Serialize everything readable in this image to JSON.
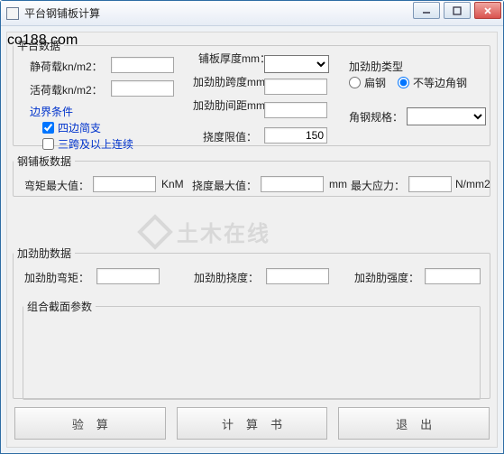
{
  "window": {
    "title": "平台钢铺板计算"
  },
  "platform": {
    "legend": "平台数据",
    "static_load_label": "静荷载kn/m2：",
    "live_load_label": "活荷载kn/m2：",
    "static_load_value": "",
    "live_load_value": "",
    "plate_thickness_label": "铺板厚度mm：",
    "stiffener_span_label": "加劲肋跨度mm：",
    "stiffener_spacing_label": "加劲肋间距mm：",
    "deflection_limit_label": "挠度限值：",
    "deflection_limit_value": "150",
    "boundary_legend": "边界条件",
    "boundary_opt1": "四边简支",
    "boundary_opt2": "三跨及以上连续",
    "stiffener_type_label": "加劲肋类型",
    "radio_flat": "扁钢",
    "radio_angle": "不等边角钢",
    "angle_spec_label": "角钢规格："
  },
  "plate": {
    "legend": "钢铺板数据",
    "moment_label": "弯矩最大值：",
    "moment_unit": "KnM",
    "deflection_label": "挠度最大值：",
    "deflection_unit": "mm",
    "stress_label": "最大应力：",
    "stress_unit": "N/mm2"
  },
  "stiffener": {
    "legend": "加劲肋数据",
    "moment_label": "加劲肋弯矩：",
    "deflection_label": "加劲肋挠度：",
    "strength_label": "加劲肋强度：",
    "section_legend": "组合截面参数"
  },
  "buttons": {
    "calc": "验算",
    "report": "计算书",
    "exit": "退出"
  },
  "watermark": {
    "main": "土木在线",
    "sub": "co188.com"
  }
}
